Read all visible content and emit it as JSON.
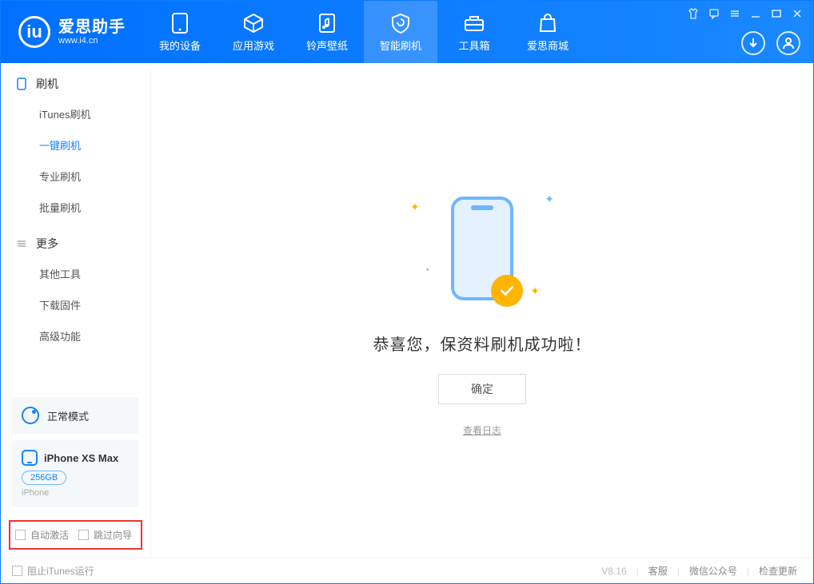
{
  "app": {
    "name_cn": "爱思助手",
    "name_en": "www.i4.cn"
  },
  "nav": {
    "items": [
      {
        "label": "我的设备"
      },
      {
        "label": "应用游戏"
      },
      {
        "label": "铃声壁纸"
      },
      {
        "label": "智能刷机"
      },
      {
        "label": "工具箱"
      },
      {
        "label": "爱思商城"
      }
    ]
  },
  "sidebar": {
    "section1_title": "刷机",
    "section1_items": [
      {
        "label": "iTunes刷机"
      },
      {
        "label": "一键刷机"
      },
      {
        "label": "专业刷机"
      },
      {
        "label": "批量刷机"
      }
    ],
    "section2_title": "更多",
    "section2_items": [
      {
        "label": "其他工具"
      },
      {
        "label": "下载固件"
      },
      {
        "label": "高级功能"
      }
    ],
    "mode_label": "正常模式",
    "device": {
      "name": "iPhone XS Max",
      "storage": "256GB",
      "type": "iPhone"
    },
    "chk_auto_activate": "自动激活",
    "chk_skip_guide": "跳过向导"
  },
  "main": {
    "success_msg": "恭喜您，保资料刷机成功啦！",
    "ok_button": "确定",
    "view_log": "查看日志"
  },
  "footer": {
    "block_itunes": "阻止iTunes运行",
    "version": "V8.16",
    "links": [
      {
        "label": "客服"
      },
      {
        "label": "微信公众号"
      },
      {
        "label": "检查更新"
      }
    ]
  }
}
